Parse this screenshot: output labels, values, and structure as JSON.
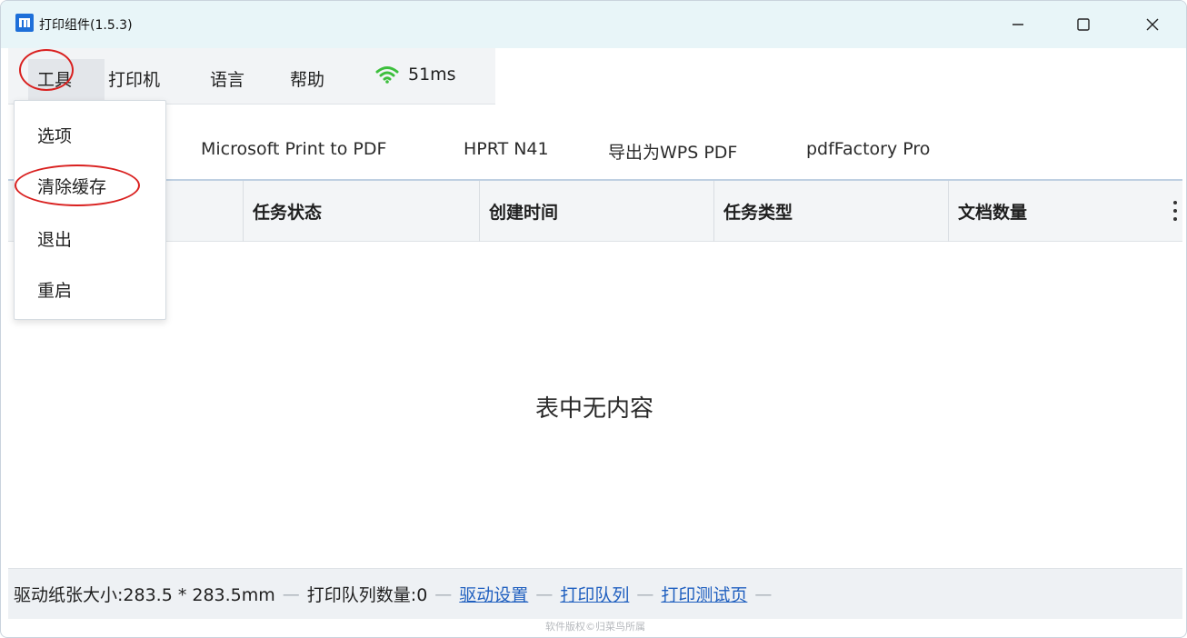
{
  "window": {
    "title": "打印组件(1.5.3)",
    "app_icon_text": "[]"
  },
  "menu": {
    "tools": "工具",
    "printer": "打印机",
    "language": "语言",
    "help": "帮助",
    "latency": "51ms"
  },
  "dropdown": {
    "items": [
      "选项",
      "清除缓存",
      "退出",
      "重启"
    ]
  },
  "printer_tabs": [
    "Microsoft Print to PDF",
    "HPRT N41",
    "导出为WPS PDF",
    "pdfFactory Pro"
  ],
  "table": {
    "columns": [
      "任务状态",
      "创建时间",
      "任务类型",
      "文档数量"
    ],
    "empty_text": "表中无内容"
  },
  "statusbar": {
    "paper_size": "驱动纸张大小:283.5 * 283.5mm",
    "queue_count": "打印队列数量:0",
    "driver_settings": "驱动设置",
    "print_queue": "打印队列",
    "print_test_page": "打印测试页",
    "separator": "—"
  },
  "footer": {
    "copyright": "软件版权©归菜鸟所属"
  },
  "colors": {
    "accent": "#1e6fd9",
    "wifi": "#3cbf3c",
    "annotation": "#d9201f",
    "link": "#1f5fbf"
  }
}
